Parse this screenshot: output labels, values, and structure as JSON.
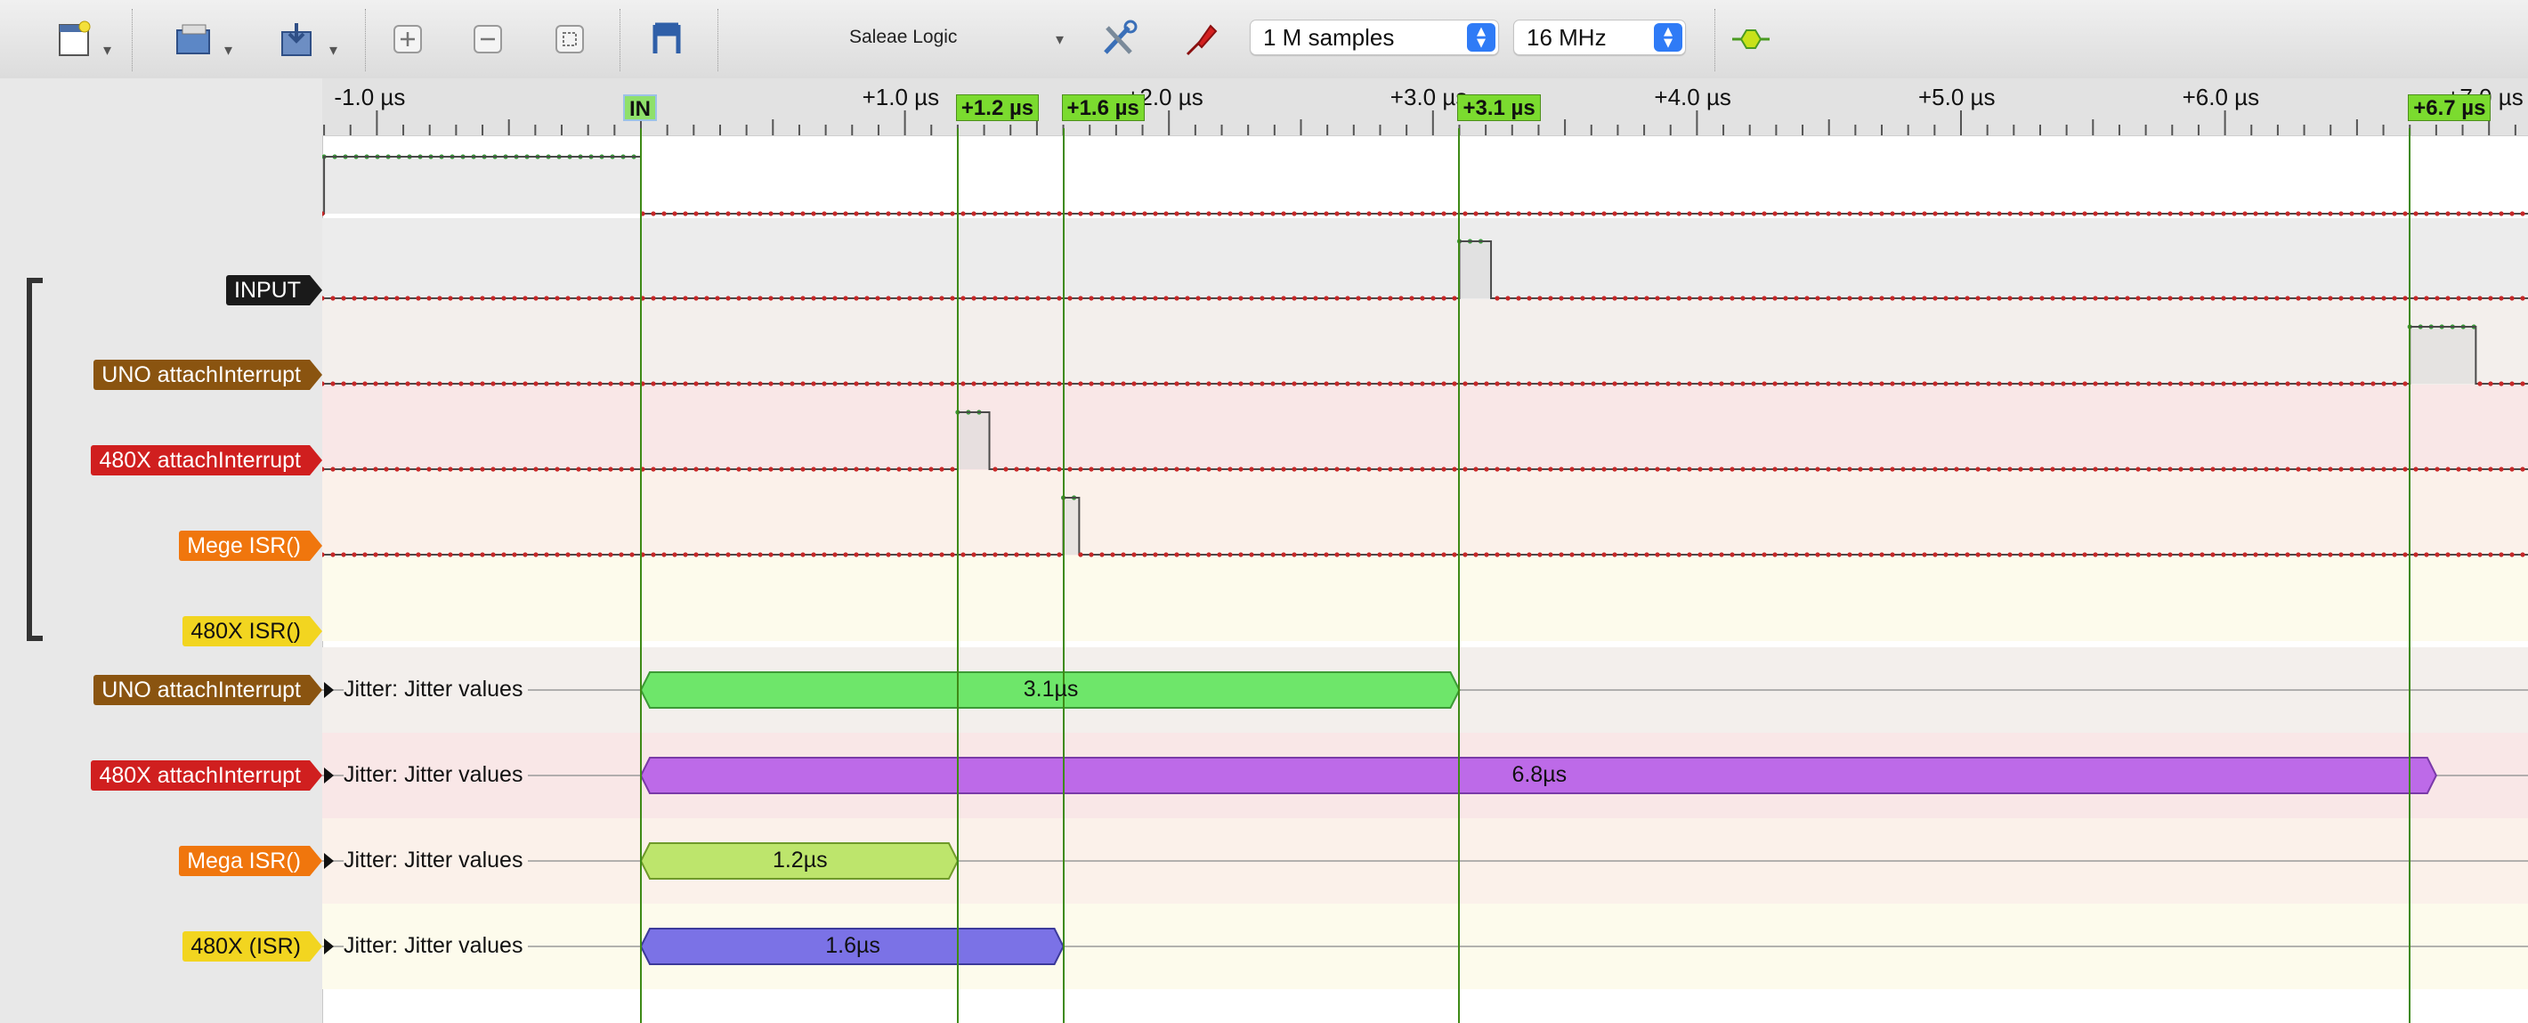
{
  "toolbar": {
    "app_title": "Saleae Logic",
    "samples_select": "1 M samples",
    "rate_select": "16 MHz",
    "icons": [
      "new-session-icon",
      "open-icon",
      "save-export-icon",
      "zoom-in-icon",
      "zoom-out-icon",
      "zoom-fit-icon",
      "markers-icon",
      "options-icon",
      "trigger-icon",
      "protocol-analyzer-icon"
    ],
    "dropdown_arrow": "▾",
    "stepper_up": "▲",
    "stepper_down": "▼"
  },
  "ruler": {
    "tick_labels": [
      "-1.0 µs",
      "+1.0 µs",
      "+2.0 µs",
      "+3.0 µs",
      "+4.0 µs",
      "+5.0 µs",
      "+6.0 µs",
      "+7.0 µs"
    ],
    "markers": [
      {
        "label": "IN",
        "time_us": 0
      },
      {
        "label": "+1.2 µs",
        "time_us": 1.2
      },
      {
        "label": "+1.6 µs",
        "time_us": 1.6
      },
      {
        "label": "+3.1 µs",
        "time_us": 3.1
      },
      {
        "label": "+6.7 µs",
        "time_us": 6.7
      }
    ]
  },
  "channels": [
    {
      "label": "INPUT",
      "color": "#1a1a1a",
      "row_color": "#ececec"
    },
    {
      "label": "UNO attachInterrupt",
      "color": "#8a5410",
      "row_color": "#f3efec"
    },
    {
      "label": "480X attachInterrupt",
      "color": "#d01f1f",
      "row_color": "#f9e7e7"
    },
    {
      "label": "Mege ISR()",
      "color": "#f0760d",
      "row_color": "#fbf1ea"
    },
    {
      "label": "480X ISR()",
      "color": "#f2d520",
      "row_color": "#fdfbec"
    }
  ],
  "analyzers": [
    {
      "label": "UNO attachInterrupt",
      "color": "#8a5410",
      "row_color": "#f3efec",
      "text": "Jitter: Jitter values",
      "value": "3.1µs",
      "bar_color": "#6ee66a",
      "bar_border": "#3c9a36"
    },
    {
      "label": "480X attachInterrupt",
      "color": "#d01f1f",
      "row_color": "#f9e7e7",
      "text": "Jitter: Jitter values",
      "value": "6.8µs",
      "bar_color": "#bd6ae8",
      "bar_border": "#7a3aa8"
    },
    {
      "label": "Mega ISR()",
      "color": "#f0760d",
      "row_color": "#fbf1ea",
      "text": "Jitter: Jitter values",
      "value": "1.2µs",
      "bar_color": "#bde56c",
      "bar_border": "#6f9a2a"
    },
    {
      "label": "480X (ISR)",
      "color": "#f2d520",
      "row_color": "#fdfbec",
      "text": "Jitter: Jitter values",
      "value": "1.6µs",
      "bar_color": "#7b72e6",
      "bar_border": "#3c3a9a"
    }
  ]
}
